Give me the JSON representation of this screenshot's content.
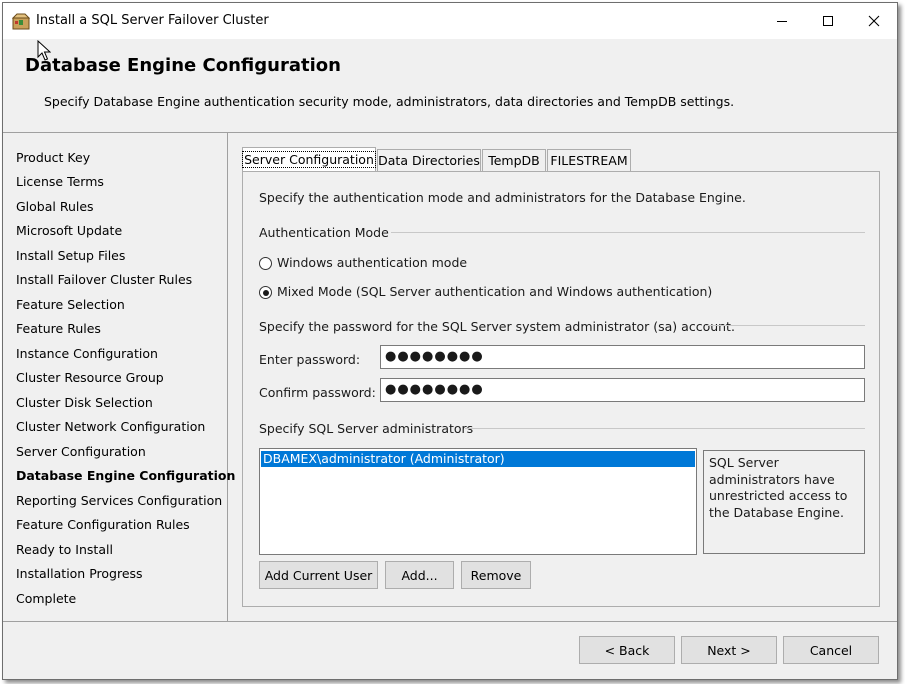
{
  "window": {
    "title": "Install a SQL Server Failover Cluster",
    "icon": "sql-setup-box-icon"
  },
  "header": {
    "title": "Database Engine Configuration",
    "description": "Specify Database Engine authentication security mode, administrators, data directories and TempDB settings."
  },
  "nav": {
    "items": [
      {
        "label": "Product Key",
        "active": false
      },
      {
        "label": "License Terms",
        "active": false
      },
      {
        "label": "Global Rules",
        "active": false
      },
      {
        "label": "Microsoft Update",
        "active": false
      },
      {
        "label": "Install Setup Files",
        "active": false
      },
      {
        "label": "Install Failover Cluster Rules",
        "active": false
      },
      {
        "label": "Feature Selection",
        "active": false
      },
      {
        "label": "Feature Rules",
        "active": false
      },
      {
        "label": "Instance Configuration",
        "active": false
      },
      {
        "label": "Cluster Resource Group",
        "active": false
      },
      {
        "label": "Cluster Disk Selection",
        "active": false
      },
      {
        "label": "Cluster Network Configuration",
        "active": false
      },
      {
        "label": "Server Configuration",
        "active": false
      },
      {
        "label": "Database Engine Configuration",
        "active": true
      },
      {
        "label": "Reporting Services Configuration",
        "active": false
      },
      {
        "label": "Feature Configuration Rules",
        "active": false
      },
      {
        "label": "Ready to Install",
        "active": false
      },
      {
        "label": "Installation Progress",
        "active": false
      },
      {
        "label": "Complete",
        "active": false
      }
    ]
  },
  "tabs": [
    {
      "label": "Server Configuration",
      "active": true
    },
    {
      "label": "Data Directories",
      "active": false
    },
    {
      "label": "TempDB",
      "active": false
    },
    {
      "label": "FILESTREAM",
      "active": false
    }
  ],
  "server_config": {
    "intro": "Specify the authentication mode and administrators for the Database Engine.",
    "auth_group_label": "Authentication Mode",
    "auth_options": [
      {
        "label": "Windows authentication mode",
        "checked": false
      },
      {
        "label": "Mixed Mode (SQL Server authentication and Windows authentication)",
        "checked": true
      }
    ],
    "password_group_label": "Specify the password for the SQL Server system administrator (sa) account.",
    "enter_password_label": "Enter password:",
    "enter_password_value": "●●●●●●●●",
    "confirm_password_label": "Confirm password:",
    "confirm_password_value": "●●●●●●●●",
    "admins_group_label": "Specify SQL Server administrators",
    "admins": [
      "DBAMEX\\administrator (Administrator)"
    ],
    "admins_info": "SQL Server administrators have unrestricted access to the Database Engine.",
    "add_current_user_label": "Add Current User",
    "add_label": "Add...",
    "remove_label": "Remove"
  },
  "footer": {
    "back_label": "< Back",
    "next_label": "Next >",
    "cancel_label": "Cancel"
  }
}
